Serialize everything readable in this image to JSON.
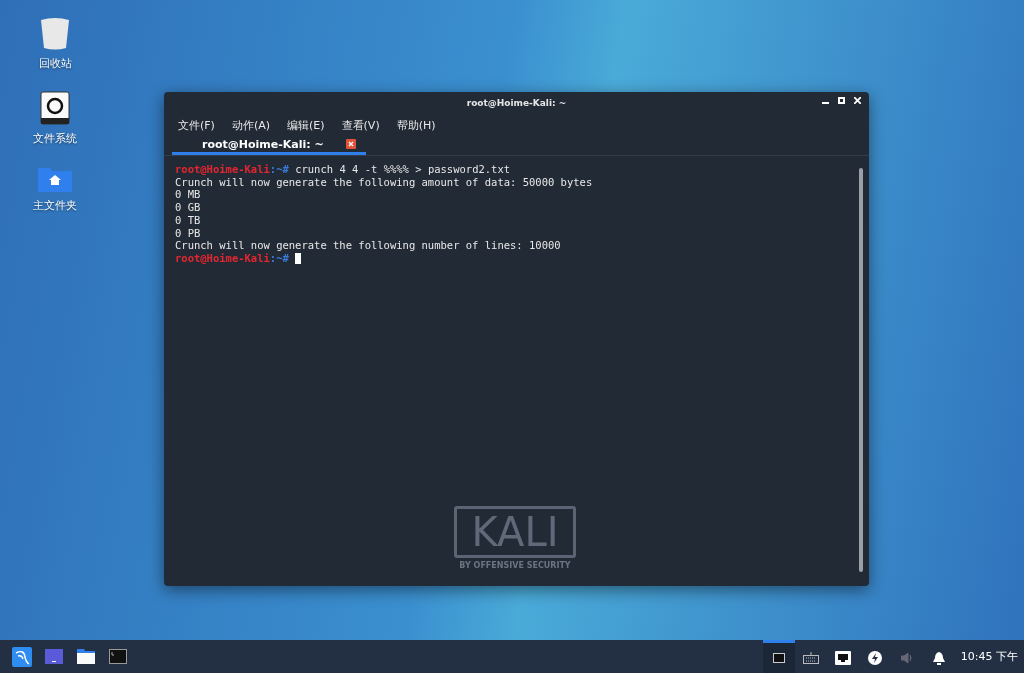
{
  "desktop_icons": [
    {
      "kind": "trash",
      "label": "回收站"
    },
    {
      "kind": "drive",
      "label": "文件系统"
    },
    {
      "kind": "home",
      "label": "主文件夹"
    }
  ],
  "window": {
    "title": "root@Hoime-Kali: ~"
  },
  "menu": [
    "文件(F)",
    "动作(A)",
    "编辑(E)",
    "查看(V)",
    "帮助(H)"
  ],
  "tabs": [
    {
      "label": "root@Hoime-Kali: ~",
      "selected": true
    }
  ],
  "terminal": {
    "lines": [
      {
        "kind": "prompt",
        "user": "root@Hoime-Kali",
        "path": ":~#",
        "command": "crunch 4 4 -t %%%% > password2.txt",
        "cursor": false
      },
      {
        "kind": "output",
        "text": "Crunch will now generate the following amount of data: 50000 bytes"
      },
      {
        "kind": "output",
        "text": "0 MB"
      },
      {
        "kind": "output",
        "text": "0 GB"
      },
      {
        "kind": "output",
        "text": "0 TB"
      },
      {
        "kind": "output",
        "text": "0 PB"
      },
      {
        "kind": "output",
        "text": "Crunch will now generate the following number of lines: 10000"
      },
      {
        "kind": "prompt",
        "user": "root@Hoime-Kali",
        "path": ":~#",
        "cursor": true
      }
    ],
    "logo": {
      "title": "KALI",
      "subtitle": "BY OFFENSIVE SECURITY"
    }
  },
  "taskbar": {
    "apps": [
      {
        "kind": "kali"
      },
      {
        "kind": "desktop"
      },
      {
        "kind": "files"
      },
      {
        "kind": "terminal"
      }
    ],
    "tray": [
      {
        "kind": "window",
        "selected": true
      },
      {
        "kind": "keyboard",
        "selected": false
      },
      {
        "kind": "network",
        "selected": false
      },
      {
        "kind": "power",
        "selected": false
      },
      {
        "kind": "volume",
        "selected": false
      },
      {
        "kind": "bell",
        "selected": false
      }
    ],
    "clock": "10:45 下午"
  }
}
